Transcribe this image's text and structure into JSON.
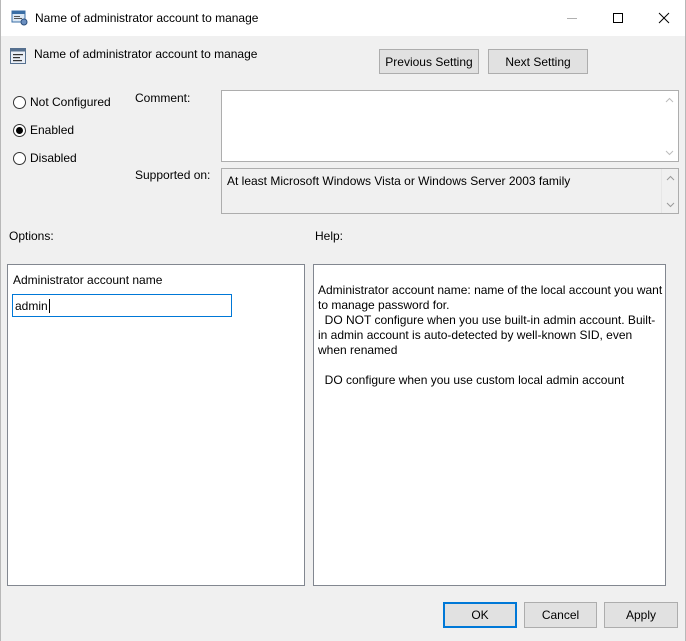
{
  "window": {
    "title": "Name of administrator account to manage",
    "header_title": "Name of administrator account to manage",
    "icon": "policy-setting-icon"
  },
  "titlebar_buttons": {
    "minimize": "minimize-icon",
    "maximize": "maximize-icon",
    "close": "close-icon"
  },
  "nav": {
    "previous_label": "Previous Setting",
    "next_label": "Next Setting"
  },
  "state": {
    "options": [
      {
        "label": "Not Configured",
        "checked": false
      },
      {
        "label": "Enabled",
        "checked": true
      },
      {
        "label": "Disabled",
        "checked": false
      }
    ]
  },
  "comment": {
    "label": "Comment:",
    "value": ""
  },
  "supported": {
    "label": "Supported on:",
    "value": "At least Microsoft Windows Vista or Windows Server 2003 family"
  },
  "options_section": {
    "label": "Options:",
    "field_label": "Administrator account name",
    "field_value": "admin"
  },
  "help_section": {
    "label": "Help:",
    "paragraphs": [
      "Administrator account name: name of the local account you want to manage password for.",
      "  DO NOT configure when you use built-in admin account. Built-in admin account is auto-detected by well-known SID, even when renamed",
      "",
      "  DO configure when you use custom local admin account"
    ]
  },
  "footer": {
    "ok_label": "OK",
    "cancel_label": "Cancel",
    "apply_label": "Apply"
  }
}
